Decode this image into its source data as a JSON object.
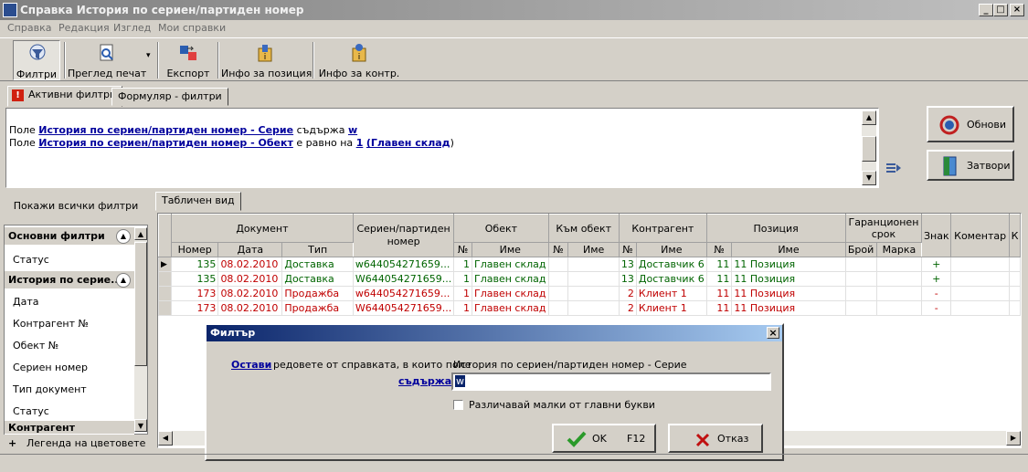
{
  "window": {
    "title": "Справка История по сериен/партиден номер",
    "min": "_",
    "max": "□",
    "close": "×"
  },
  "menu": [
    "Справка",
    "Редакция",
    "Изглед",
    "Мои справки"
  ],
  "toolbar": {
    "filters": "Филтри",
    "print_preview": "Преглед печат",
    "dropdown": "▾",
    "export": "Експорт",
    "position_info": "Инфо за позиция",
    "contr_info": "Инфо за контр."
  },
  "tabs": {
    "active_filters": "Активни филтри",
    "form_filters": "Формуляр - филтри",
    "table_view": "Табличен вид"
  },
  "filter_lines": [
    {
      "prefix": "Поле ",
      "field": "История по сериен/партиден номер - Серие",
      "op": " съдържа ",
      "value": "w",
      "value2": "",
      "suffix": ""
    },
    {
      "prefix": "Поле ",
      "field": "История по сериен/партиден номер - Обект",
      "op": " е равно на ",
      "value": "1",
      "value2": "(Главен склад",
      "suffix": ")"
    }
  ],
  "buttons": {
    "refresh": "Обнови",
    "close": "Затвори",
    "show_all_filters": "Покажи всички филтри"
  },
  "left_panel": {
    "group1": "Основни филтри",
    "group1_items": [
      "Статус"
    ],
    "group2": "История по серие...",
    "group2_items": [
      "Дата",
      "Контрагент №",
      "Обект №",
      "Сериен номер",
      "Тип документ",
      "Статус"
    ],
    "group3": "Контрагент",
    "legend": "Легенда на цветовете",
    "legend_toggle": "+"
  },
  "grid": {
    "headers_top": [
      "Документ",
      "Сериен/партиден номер",
      "Обект",
      "Към обект",
      "Контрагент",
      "Позиция",
      "Гаранционен срок",
      "Знак",
      "Коментар",
      "К"
    ],
    "headers_sub": [
      "Номер",
      "Дата",
      "Тип",
      "№",
      "Име",
      "№",
      "Име",
      "№",
      "Име",
      "№",
      "Име",
      "Брой",
      "Марка"
    ],
    "rows": [
      {
        "num": "135",
        "date": "08.02.2010",
        "type": "Доставка",
        "serial": "w644054271659...",
        "obj_no": "1",
        "obj_name": "Главен склад",
        "to_no": "",
        "to_name": "",
        "c_no": "13",
        "c_name": "Доставчик 6",
        "p_no": "11",
        "p_name": "11 Позиция",
        "sign": "+"
      },
      {
        "num": "135",
        "date": "08.02.2010",
        "type": "Доставка",
        "serial": "W644054271659...",
        "obj_no": "1",
        "obj_name": "Главен склад",
        "to_no": "",
        "to_name": "",
        "c_no": "13",
        "c_name": "Доставчик 6",
        "p_no": "11",
        "p_name": "11 Позиция",
        "sign": "+"
      },
      {
        "num": "173",
        "date": "08.02.2010",
        "type": "Продажба",
        "serial": "w644054271659...",
        "obj_no": "1",
        "obj_name": "Главен склад",
        "to_no": "",
        "to_name": "",
        "c_no": "2",
        "c_name": "Клиент 1",
        "p_no": "11",
        "p_name": "11 Позиция",
        "sign": "-"
      },
      {
        "num": "173",
        "date": "08.02.2010",
        "type": "Продажба",
        "serial": "W644054271659...",
        "obj_no": "1",
        "obj_name": "Главен склад",
        "to_no": "",
        "to_name": "",
        "c_no": "2",
        "c_name": "Клиент 1",
        "p_no": "11",
        "p_name": "11 Позиция",
        "sign": "-"
      }
    ]
  },
  "dialog": {
    "title": "Филтър",
    "keep": "Остави",
    "rows_text": "редовете от справката, в които поле",
    "field": "История по сериен/партиден номер - Серие",
    "operator": "съдържа",
    "value": "w",
    "case_label": "Различавай малки от главни букви",
    "ok": "OK",
    "ok_key": "F12",
    "cancel": "Отказ",
    "close": "×"
  },
  "colors": {
    "green": "#006400",
    "red": "#c00000",
    "link": "#00009c"
  }
}
